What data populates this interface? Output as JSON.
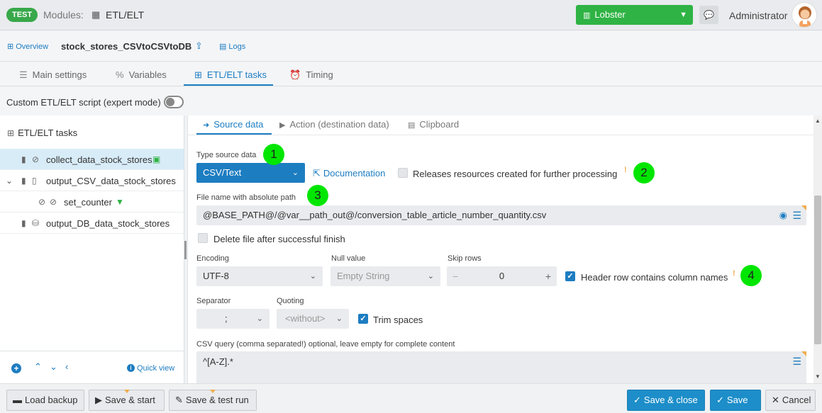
{
  "topbar": {
    "env_badge": "TEST",
    "modules_label": "Modules:",
    "module_title": "ETL/ELT",
    "instance_select": "Lobster",
    "user_name": "Administrator"
  },
  "breadcrumb": {
    "overview": "Overview",
    "job_title": "stock_stores_CSVtoCSVtoDB",
    "logs": "Logs"
  },
  "main_tabs": [
    {
      "label": "Main settings",
      "icon": "list-icon"
    },
    {
      "label": "Variables",
      "icon": "percent-icon"
    },
    {
      "label": "ETL/ELT tasks",
      "icon": "tasks-icon",
      "active": true
    },
    {
      "label": "Timing",
      "icon": "alarm-clock-icon"
    }
  ],
  "expert_mode": {
    "label": "Custom ETL/ELT script (expert mode)",
    "enabled": false
  },
  "left_panel": {
    "title": "ETL/ELT tasks",
    "tree": [
      {
        "label": "collect_data_stock_stores",
        "selected": true
      },
      {
        "label": "output_CSV_data_stock_stores"
      },
      {
        "label": "set_counter"
      },
      {
        "label": "output_DB_data_stock_stores"
      }
    ],
    "quick_view": "Quick view"
  },
  "sub_tabs": [
    {
      "label": "Source data",
      "active": true
    },
    {
      "label": "Action (destination data)"
    },
    {
      "label": "Clipboard"
    }
  ],
  "form": {
    "type_source_label": "Type source data",
    "type_source_value": "CSV/Text",
    "documentation": "Documentation",
    "releases_label": "Releases resources created for further processing",
    "file_name_label": "File name with absolute path",
    "file_name_value": "@BASE_PATH@/@var__path_out@/conversion_table_article_number_quantity.csv",
    "delete_file_label": "Delete file after successful finish",
    "encoding_label": "Encoding",
    "encoding_value": "UTF-8",
    "null_value_label": "Null value",
    "null_value_value": "Empty String",
    "skip_rows_label": "Skip rows",
    "skip_rows_value": "0",
    "header_row_label": "Header row contains column names",
    "separator_label": "Separator",
    "separator_value": ";",
    "quoting_label": "Quoting",
    "quoting_value": "<without>",
    "trim_spaces_label": "Trim spaces",
    "csv_query_label": "CSV query (comma separated!) optional, leave empty for complete content",
    "csv_query_value": "^[A-Z].*"
  },
  "annotations": [
    "1",
    "2",
    "3",
    "4"
  ],
  "bottom_bar": {
    "load_backup": "Load backup",
    "save_start": "Save & start",
    "save_test_run": "Save & test run",
    "save_close": "Save & close",
    "save": "Save",
    "cancel": "Cancel"
  },
  "colors": {
    "accent": "#1d7dc1",
    "success": "#2fb344",
    "annotation": "#00e600",
    "warning": "#f0ad4e"
  }
}
